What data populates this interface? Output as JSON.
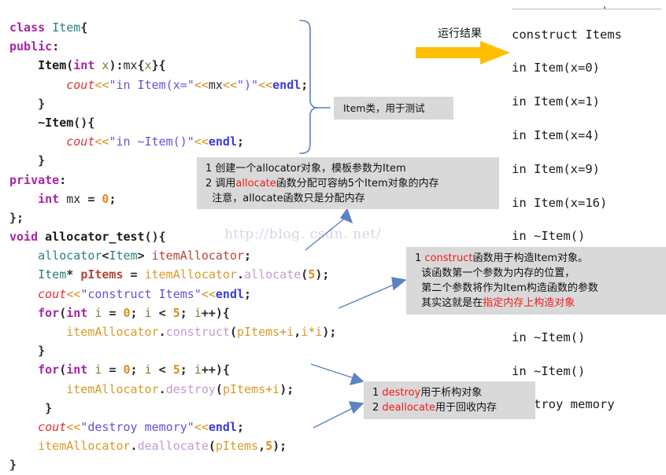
{
  "code": {
    "lines": [
      [
        {
          "t": "class ",
          "c": "kw"
        },
        {
          "t": "Item",
          "c": "type"
        },
        {
          "t": "{",
          "c": "punc"
        }
      ],
      [
        {
          "t": "public",
          "c": "kw"
        },
        {
          "t": ":",
          "c": "punc"
        }
      ],
      [
        {
          "t": "    ",
          "c": "id"
        },
        {
          "t": "Item",
          "c": "typeb"
        },
        {
          "t": "(",
          "c": "punc"
        },
        {
          "t": "int",
          "c": "kw"
        },
        {
          "t": " ",
          "c": "id"
        },
        {
          "t": "x",
          "c": "var"
        },
        {
          "t": ")",
          "c": "punc"
        },
        {
          "t": ":",
          "c": "punc"
        },
        {
          "t": "mx",
          "c": "id"
        },
        {
          "t": "{",
          "c": "punc"
        },
        {
          "t": "x",
          "c": "var"
        },
        {
          "t": "}{",
          "c": "punc"
        }
      ],
      [
        {
          "t": "        ",
          "c": "id"
        },
        {
          "t": "cout",
          "c": "cout"
        },
        {
          "t": "<<",
          "c": "op"
        },
        {
          "t": "\"in Item(x=\"",
          "c": "str"
        },
        {
          "t": "<<",
          "c": "op"
        },
        {
          "t": "mx",
          "c": "id"
        },
        {
          "t": "<<",
          "c": "op"
        },
        {
          "t": "\")\"",
          "c": "str"
        },
        {
          "t": "<<",
          "c": "op"
        },
        {
          "t": "endl",
          "c": "endl"
        },
        {
          "t": ";",
          "c": "punc"
        }
      ],
      [
        {
          "t": "    }",
          "c": "punc"
        }
      ],
      [
        {
          "t": "    ",
          "c": "id"
        },
        {
          "t": "~Item",
          "c": "typeb"
        },
        {
          "t": "(){",
          "c": "punc"
        }
      ],
      [
        {
          "t": "        ",
          "c": "id"
        },
        {
          "t": "cout",
          "c": "cout"
        },
        {
          "t": "<<",
          "c": "op"
        },
        {
          "t": "\"in ~Item()\"",
          "c": "str"
        },
        {
          "t": "<<",
          "c": "op"
        },
        {
          "t": "endl",
          "c": "endl"
        },
        {
          "t": ";",
          "c": "punc"
        }
      ],
      [
        {
          "t": "    }",
          "c": "punc"
        }
      ],
      [
        {
          "t": "private",
          "c": "kw"
        },
        {
          "t": ":",
          "c": "punc"
        }
      ],
      [
        {
          "t": "    ",
          "c": "id"
        },
        {
          "t": "int",
          "c": "kw"
        },
        {
          "t": " ",
          "c": "id"
        },
        {
          "t": "mx",
          "c": "id"
        },
        {
          "t": " ",
          "c": "id"
        },
        {
          "t": "=",
          "c": "punc"
        },
        {
          "t": " ",
          "c": "id"
        },
        {
          "t": "0",
          "c": "num"
        },
        {
          "t": ";",
          "c": "punc"
        }
      ],
      [
        {
          "t": "};",
          "c": "punc"
        }
      ],
      [
        {
          "t": "void",
          "c": "kw"
        },
        {
          "t": " ",
          "c": "id"
        },
        {
          "t": "allocator_test",
          "c": "fname"
        },
        {
          "t": "(){",
          "c": "punc"
        }
      ],
      [
        {
          "t": "    ",
          "c": "id"
        },
        {
          "t": "allocator",
          "c": "type"
        },
        {
          "t": "<",
          "c": "punc"
        },
        {
          "t": "Item",
          "c": "type"
        },
        {
          "t": ">",
          "c": "punc"
        },
        {
          "t": " ",
          "c": "id"
        },
        {
          "t": "itemAllocator",
          "c": "obj"
        },
        {
          "t": ";",
          "c": "punc"
        }
      ],
      [
        {
          "t": "    ",
          "c": "id"
        },
        {
          "t": "Item",
          "c": "type"
        },
        {
          "t": "*",
          "c": "punc"
        },
        {
          "t": " ",
          "c": "id"
        },
        {
          "t": "pItems",
          "c": "ptr"
        },
        {
          "t": " ",
          "c": "id"
        },
        {
          "t": "=",
          "c": "punc"
        },
        {
          "t": " ",
          "c": "id"
        },
        {
          "t": "itemAllocator",
          "c": "objref"
        },
        {
          "t": ".",
          "c": "punc"
        },
        {
          "t": "allocate",
          "c": "meth"
        },
        {
          "t": "(",
          "c": "punc"
        },
        {
          "t": "5",
          "c": "num"
        },
        {
          "t": ");",
          "c": "punc"
        }
      ],
      [
        {
          "t": "    ",
          "c": "id"
        },
        {
          "t": "cout",
          "c": "cout"
        },
        {
          "t": "<<",
          "c": "op"
        },
        {
          "t": "\"construct Items\"",
          "c": "str"
        },
        {
          "t": "<<",
          "c": "op"
        },
        {
          "t": "endl",
          "c": "endl"
        },
        {
          "t": ";",
          "c": "punc"
        }
      ],
      [
        {
          "t": "    ",
          "c": "id"
        },
        {
          "t": "for",
          "c": "kw"
        },
        {
          "t": "(",
          "c": "punc"
        },
        {
          "t": "int",
          "c": "kw"
        },
        {
          "t": " ",
          "c": "id"
        },
        {
          "t": "i",
          "c": "var"
        },
        {
          "t": " ",
          "c": "id"
        },
        {
          "t": "=",
          "c": "punc"
        },
        {
          "t": " ",
          "c": "id"
        },
        {
          "t": "0",
          "c": "num"
        },
        {
          "t": "; ",
          "c": "punc"
        },
        {
          "t": "i",
          "c": "var"
        },
        {
          "t": " ",
          "c": "id"
        },
        {
          "t": "<",
          "c": "punc"
        },
        {
          "t": " ",
          "c": "id"
        },
        {
          "t": "5",
          "c": "num"
        },
        {
          "t": "; ",
          "c": "punc"
        },
        {
          "t": "i",
          "c": "var"
        },
        {
          "t": "++){",
          "c": "punc"
        }
      ],
      [
        {
          "t": "        ",
          "c": "id"
        },
        {
          "t": "itemAllocator",
          "c": "objref"
        },
        {
          "t": ".",
          "c": "punc"
        },
        {
          "t": "construct",
          "c": "meth"
        },
        {
          "t": "(",
          "c": "punc"
        },
        {
          "t": "pItems",
          "c": "objref"
        },
        {
          "t": "+",
          "c": "op"
        },
        {
          "t": "i",
          "c": "objref"
        },
        {
          "t": ",",
          "c": "punc"
        },
        {
          "t": "i",
          "c": "objref"
        },
        {
          "t": "*",
          "c": "op"
        },
        {
          "t": "i",
          "c": "objref"
        },
        {
          "t": ");",
          "c": "punc"
        }
      ],
      [
        {
          "t": "    }",
          "c": "punc"
        }
      ],
      [
        {
          "t": "    ",
          "c": "id"
        },
        {
          "t": "for",
          "c": "kw"
        },
        {
          "t": "(",
          "c": "punc"
        },
        {
          "t": "int",
          "c": "kw"
        },
        {
          "t": " ",
          "c": "id"
        },
        {
          "t": "i",
          "c": "var"
        },
        {
          "t": " ",
          "c": "id"
        },
        {
          "t": "=",
          "c": "punc"
        },
        {
          "t": " ",
          "c": "id"
        },
        {
          "t": "0",
          "c": "num"
        },
        {
          "t": "; ",
          "c": "punc"
        },
        {
          "t": "i",
          "c": "var"
        },
        {
          "t": " ",
          "c": "id"
        },
        {
          "t": "<",
          "c": "punc"
        },
        {
          "t": " ",
          "c": "id"
        },
        {
          "t": "5",
          "c": "num"
        },
        {
          "t": "; ",
          "c": "punc"
        },
        {
          "t": "i",
          "c": "var"
        },
        {
          "t": "++){",
          "c": "punc"
        }
      ],
      [
        {
          "t": "        ",
          "c": "id"
        },
        {
          "t": "itemAllocator",
          "c": "objref"
        },
        {
          "t": ".",
          "c": "punc"
        },
        {
          "t": "destroy",
          "c": "meth"
        },
        {
          "t": "(",
          "c": "punc"
        },
        {
          "t": "pItems",
          "c": "objref"
        },
        {
          "t": "+",
          "c": "op"
        },
        {
          "t": "i",
          "c": "objref"
        },
        {
          "t": ");",
          "c": "punc"
        }
      ],
      [
        {
          "t": "     }",
          "c": "punc"
        }
      ],
      [
        {
          "t": "    ",
          "c": "id"
        },
        {
          "t": "cout",
          "c": "cout"
        },
        {
          "t": "<<",
          "c": "op"
        },
        {
          "t": "\"destroy memory\"",
          "c": "str"
        },
        {
          "t": "<<",
          "c": "op"
        },
        {
          "t": "endl",
          "c": "endl"
        },
        {
          "t": ";",
          "c": "punc"
        }
      ],
      [
        {
          "t": "    ",
          "c": "id"
        },
        {
          "t": "itemAllocator",
          "c": "objref"
        },
        {
          "t": ".",
          "c": "punc"
        },
        {
          "t": "deallocate",
          "c": "meth"
        },
        {
          "t": "(",
          "c": "punc"
        },
        {
          "t": "pItems",
          "c": "objref"
        },
        {
          "t": ",",
          "c": "punc"
        },
        {
          "t": "5",
          "c": "num"
        },
        {
          "t": ");",
          "c": "punc"
        }
      ],
      [
        {
          "t": "}",
          "c": "punc"
        }
      ]
    ]
  },
  "console": {
    "lines": [
      "construct Items",
      "in Item(x=0)",
      "in Item(x=1)",
      "in Item(x=4)",
      "in Item(x=9)",
      "in Item(x=16)",
      "in ~Item()",
      "in ~Item()",
      "in ~Item()",
      "in ~Item()",
      "in ~Item()",
      "destroy memory"
    ]
  },
  "labels": {
    "run_result": "运行结果"
  },
  "callouts": {
    "item_class": {
      "text": "Item类，用于测试"
    },
    "allocate": {
      "line1_a": "1 创建一个allocator对象，模板参数为Item",
      "line2_a": "2 调用",
      "line2_red": "allocate",
      "line2_b": "函数分配可容纳5个Item对象的内存",
      "line3": "  注意，allocate函数只是分配内存"
    },
    "construct": {
      "line1_a": "1 ",
      "line1_red": "construct",
      "line1_b": "函数用于构造Item对象。",
      "line2": "  该函数第一个参数为内存的位置，",
      "line3": "  第二个参数将作为Item构造函数的参数",
      "line4_a": "  其实这就是在",
      "line4_red": "指定内存上构造对象"
    },
    "destroy": {
      "line1_a": "1 ",
      "line1_red": "destroy",
      "line1_b": "用于析构对象",
      "line2_a": "2 ",
      "line2_red": "deallocate",
      "line2_b": "用于回收内存"
    }
  },
  "watermark": {
    "text": "http://blog. csdn. net/"
  },
  "colors": {
    "arrow_orange": "#FFBF00",
    "connector_blue": "#5b82c4",
    "callout_bg": "#d9d9d9",
    "highlight_red": "#ee1c1c"
  }
}
